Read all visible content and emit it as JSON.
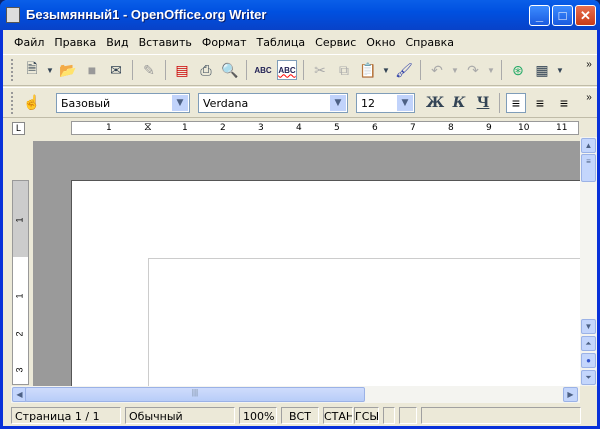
{
  "window": {
    "title": "Безымянный1 - OpenOffice.org Writer",
    "minimize": "_",
    "maximize": "□",
    "close": "✕"
  },
  "menu": [
    "Файл",
    "Правка",
    "Вид",
    "Вставить",
    "Формат",
    "Таблица",
    "Сервис",
    "Окно",
    "Справка"
  ],
  "standard_toolbar": {
    "icons": [
      "new-icon",
      "open-icon",
      "save-icon",
      "email-icon",
      "edit-file-icon",
      "export-pdf-icon",
      "print-icon",
      "page-preview-icon",
      "spellcheck-icon",
      "autospellcheck-icon",
      "cut-icon",
      "copy-icon",
      "paste-icon",
      "format-paintbrush-icon",
      "undo-icon",
      "redo-icon",
      "navigator-icon",
      "table-icon"
    ],
    "spell_label": "ABC",
    "autospell_label": "ABC",
    "more": "»"
  },
  "formatting_toolbar": {
    "style": "Базовый",
    "font": "Verdana",
    "size": "12",
    "bold": "Ж",
    "italic": "К",
    "underline": "Ч",
    "more": "»"
  },
  "ruler": {
    "labels": [
      "1",
      "1",
      "2",
      "3",
      "4",
      "5",
      "6",
      "7",
      "8",
      "9",
      "10",
      "11"
    ],
    "vlabels": [
      "1",
      "1",
      "2",
      "3"
    ]
  },
  "status": {
    "page": "Страница  1 / 1",
    "style": "Обычный",
    "zoom": "100%",
    "insert_mode": "ВСТ",
    "selection_mode": "СТАНД",
    "hyperlink_mode": "ГСЫЛ"
  }
}
